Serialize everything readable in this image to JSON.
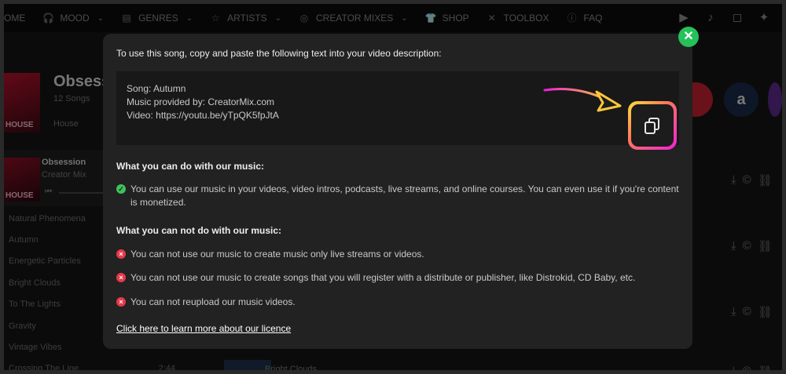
{
  "nav": {
    "items": [
      {
        "label": "OME",
        "icon": "home-icon",
        "chevron": false
      },
      {
        "label": "MOOD",
        "icon": "headphones-icon",
        "chevron": true
      },
      {
        "label": "GENRES",
        "icon": "list-icon",
        "chevron": true
      },
      {
        "label": "ARTISTS",
        "icon": "star-icon",
        "chevron": true
      },
      {
        "label": "CREATOR MIXES",
        "icon": "disc-icon",
        "chevron": true
      },
      {
        "label": "SHOP",
        "icon": "tshirt-icon",
        "chevron": false
      },
      {
        "label": "TOOLBOX",
        "icon": "tools-icon",
        "chevron": false
      },
      {
        "label": "FAQ",
        "icon": "info-icon",
        "chevron": false
      }
    ],
    "social": [
      "youtube-icon",
      "tiktok-icon",
      "instagram-icon",
      "twitter-icon"
    ]
  },
  "background": {
    "playlist_title": "Obsess",
    "song_count": "12 Songs",
    "genre": "House",
    "album_label": "HOUSE",
    "player": {
      "title": "Obsession",
      "artist": "Creator Mix",
      "label": "HOUSE"
    },
    "tracks": [
      {
        "name": "Natural Phenomena",
        "time": ""
      },
      {
        "name": "Autumn",
        "time": ""
      },
      {
        "name": "Energetic Particles",
        "time": ""
      },
      {
        "name": "Bright Clouds",
        "time": ""
      },
      {
        "name": "To The Lights",
        "time": ""
      },
      {
        "name": "Gravity",
        "time": ""
      },
      {
        "name": "Vintage Vibes",
        "time": ""
      },
      {
        "name": "Crossing The Line",
        "time": "2:44"
      }
    ],
    "bottom_track": "Bright Clouds"
  },
  "modal": {
    "intro": "To use this song, copy and paste the following text into your video description:",
    "copy_lines": [
      "Song: Autumn",
      "Music provided by: CreatorMix.com",
      "Video: https://youtu.be/yTpQK5fpJtA"
    ],
    "can_heading": "What you can do with our music:",
    "can_items": [
      "You can use our music in your videos, video intros, podcasts, live streams, and online courses. You can even use it if you're content is monetized."
    ],
    "cannot_heading": "What you can not do with our music:",
    "cannot_items": [
      "You can not use our music to create music only live streams or videos.",
      "You can not use our music to create songs that you will register with a distribute or publisher, like Distrokid, CD Baby, etc.",
      "You can not reupload our music videos."
    ],
    "licence_link": "Click here to learn more about our licence"
  },
  "colors": {
    "accent_green": "#26c15a",
    "error_red": "#e53a4a",
    "modal_bg": "#222222"
  }
}
